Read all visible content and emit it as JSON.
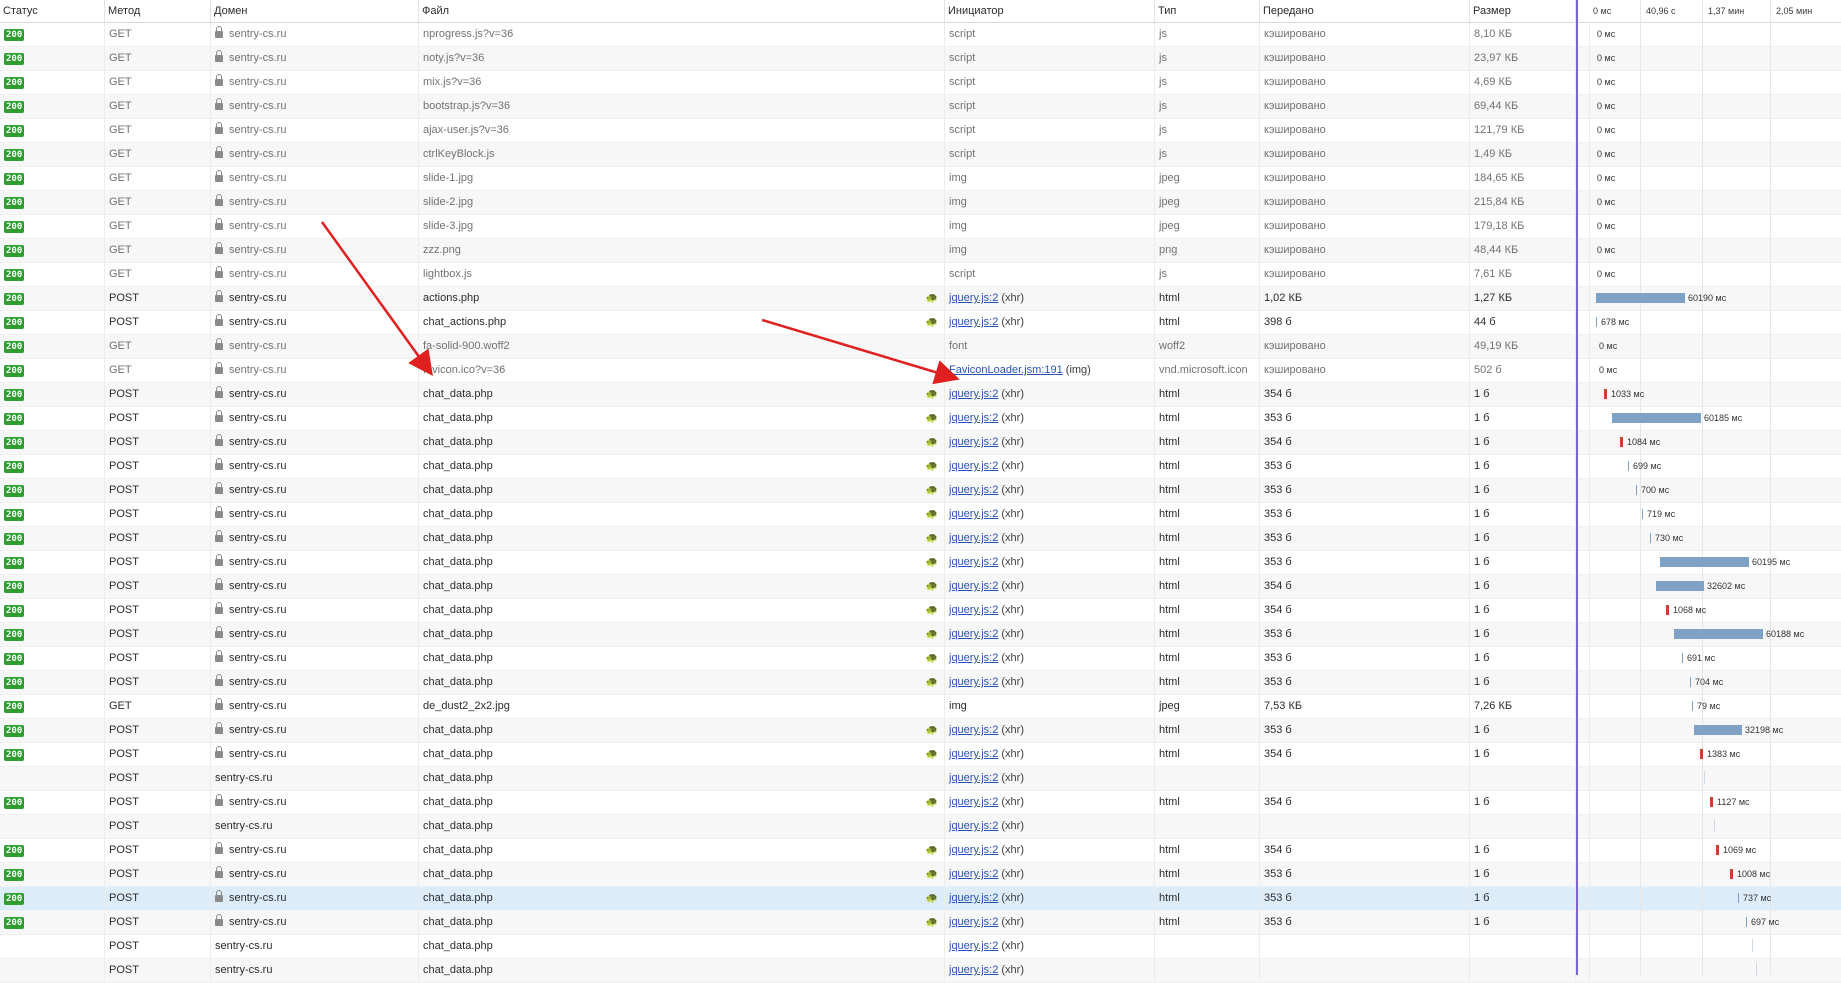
{
  "columns": {
    "status": "Статус",
    "method": "Метод",
    "domain": "Домен",
    "file": "Файл",
    "initiator": "Инициатор",
    "type": "Тип",
    "transferred": "Передано",
    "size": "Размер"
  },
  "timeline": {
    "ticks": [
      "0 мс",
      "40,96 с",
      "1,37 мин",
      "2,05 мин"
    ]
  },
  "colors": {
    "status_ok": "#2e9e2e",
    "bar": "#7fa1c5",
    "bar_red": "#d23b2f",
    "marker": "#7b63d0",
    "arrow": "#e02020",
    "link": "#2753b5",
    "selected": "#dcecf9"
  },
  "requests": [
    {
      "status": "200",
      "method": "GET",
      "domain": "sentry-cs.ru",
      "file": "nprogress.js?v=36",
      "initiator": "script",
      "init_suffix": "",
      "type": "js",
      "transferred": "кэшировано",
      "size": "8,10 КБ",
      "time": "0 мс",
      "cached": true
    },
    {
      "status": "200",
      "method": "GET",
      "domain": "sentry-cs.ru",
      "file": "noty.js?v=36",
      "initiator": "script",
      "init_suffix": "",
      "type": "js",
      "transferred": "кэшировано",
      "size": "23,97 КБ",
      "time": "0 мс",
      "cached": true
    },
    {
      "status": "200",
      "method": "GET",
      "domain": "sentry-cs.ru",
      "file": "mix.js?v=36",
      "initiator": "script",
      "init_suffix": "",
      "type": "js",
      "transferred": "кэшировано",
      "size": "4,69 КБ",
      "time": "0 мс",
      "cached": true
    },
    {
      "status": "200",
      "method": "GET",
      "domain": "sentry-cs.ru",
      "file": "bootstrap.js?v=36",
      "initiator": "script",
      "init_suffix": "",
      "type": "js",
      "transferred": "кэшировано",
      "size": "69,44 КБ",
      "time": "0 мс",
      "cached": true
    },
    {
      "status": "200",
      "method": "GET",
      "domain": "sentry-cs.ru",
      "file": "ajax-user.js?v=36",
      "initiator": "script",
      "init_suffix": "",
      "type": "js",
      "transferred": "кэшировано",
      "size": "121,79 КБ",
      "time": "0 мс",
      "cached": true
    },
    {
      "status": "200",
      "method": "GET",
      "domain": "sentry-cs.ru",
      "file": "ctrlKeyBlock.js",
      "initiator": "script",
      "init_suffix": "",
      "type": "js",
      "transferred": "кэшировано",
      "size": "1,49 КБ",
      "time": "0 мс",
      "cached": true
    },
    {
      "status": "200",
      "method": "GET",
      "domain": "sentry-cs.ru",
      "file": "slide-1.jpg",
      "initiator": "img",
      "init_suffix": "",
      "type": "jpeg",
      "transferred": "кэшировано",
      "size": "184,65 КБ",
      "time": "0 мс",
      "cached": true
    },
    {
      "status": "200",
      "method": "GET",
      "domain": "sentry-cs.ru",
      "file": "slide-2.jpg",
      "initiator": "img",
      "init_suffix": "",
      "type": "jpeg",
      "transferred": "кэшировано",
      "size": "215,84 КБ",
      "time": "0 мс",
      "cached": true
    },
    {
      "status": "200",
      "method": "GET",
      "domain": "sentry-cs.ru",
      "file": "slide-3.jpg",
      "initiator": "img",
      "init_suffix": "",
      "type": "jpeg",
      "transferred": "кэшировано",
      "size": "179,18 КБ",
      "time": "0 мс",
      "cached": true
    },
    {
      "status": "200",
      "method": "GET",
      "domain": "sentry-cs.ru",
      "file": "zzz.png",
      "initiator": "img",
      "init_suffix": "",
      "type": "png",
      "transferred": "кэшировано",
      "size": "48,44 КБ",
      "time": "0 мс",
      "cached": true
    },
    {
      "status": "200",
      "method": "GET",
      "domain": "sentry-cs.ru",
      "file": "lightbox.js",
      "initiator": "script",
      "init_suffix": "",
      "type": "js",
      "transferred": "кэшировано",
      "size": "7,61 КБ",
      "time": "0 мс",
      "cached": true
    },
    {
      "status": "200",
      "method": "POST",
      "domain": "sentry-cs.ru",
      "file": "actions.php",
      "initiator": "jquery.js:2",
      "init_suffix": " (xhr)",
      "type": "html",
      "transferred": "1,02 КБ",
      "size": "1,27 КБ",
      "time": "60190 мс",
      "turtle": true
    },
    {
      "status": "200",
      "method": "POST",
      "domain": "sentry-cs.ru",
      "file": "chat_actions.php",
      "initiator": "jquery.js:2",
      "init_suffix": " (xhr)",
      "type": "html",
      "transferred": "398 б",
      "size": "44 б",
      "time": "678 мс",
      "turtle": true
    },
    {
      "status": "200",
      "method": "GET",
      "domain": "sentry-cs.ru",
      "file": "fa-solid-900.woff2",
      "initiator": "font",
      "init_suffix": "",
      "type": "woff2",
      "transferred": "кэшировано",
      "size": "49,19 КБ",
      "time": "0 мс",
      "cached": true
    },
    {
      "status": "200",
      "method": "GET",
      "domain": "sentry-cs.ru",
      "file": "favicon.ico?v=36",
      "initiator": "FaviconLoader.jsm:191",
      "init_suffix": " (img)",
      "type": "vnd.microsoft.icon",
      "transferred": "кэшировано",
      "size": "502 б",
      "time": "0 мс",
      "cached": true
    },
    {
      "status": "200",
      "method": "POST",
      "domain": "sentry-cs.ru",
      "file": "chat_data.php",
      "initiator": "jquery.js:2",
      "init_suffix": " (xhr)",
      "type": "html",
      "transferred": "354 б",
      "size": "1 б",
      "time": "1033 мс",
      "turtle": true
    },
    {
      "status": "200",
      "method": "POST",
      "domain": "sentry-cs.ru",
      "file": "chat_data.php",
      "initiator": "jquery.js:2",
      "init_suffix": " (xhr)",
      "type": "html",
      "transferred": "353 б",
      "size": "1 б",
      "time": "60185 мс",
      "turtle": true
    },
    {
      "status": "200",
      "method": "POST",
      "domain": "sentry-cs.ru",
      "file": "chat_data.php",
      "initiator": "jquery.js:2",
      "init_suffix": " (xhr)",
      "type": "html",
      "transferred": "354 б",
      "size": "1 б",
      "time": "1084 мс",
      "turtle": true
    },
    {
      "status": "200",
      "method": "POST",
      "domain": "sentry-cs.ru",
      "file": "chat_data.php",
      "initiator": "jquery.js:2",
      "init_suffix": " (xhr)",
      "type": "html",
      "transferred": "353 б",
      "size": "1 б",
      "time": "699 мс",
      "turtle": true
    },
    {
      "status": "200",
      "method": "POST",
      "domain": "sentry-cs.ru",
      "file": "chat_data.php",
      "initiator": "jquery.js:2",
      "init_suffix": " (xhr)",
      "type": "html",
      "transferred": "353 б",
      "size": "1 б",
      "time": "700 мс",
      "turtle": true
    },
    {
      "status": "200",
      "method": "POST",
      "domain": "sentry-cs.ru",
      "file": "chat_data.php",
      "initiator": "jquery.js:2",
      "init_suffix": " (xhr)",
      "type": "html",
      "transferred": "353 б",
      "size": "1 б",
      "time": "719 мс",
      "turtle": true
    },
    {
      "status": "200",
      "method": "POST",
      "domain": "sentry-cs.ru",
      "file": "chat_data.php",
      "initiator": "jquery.js:2",
      "init_suffix": " (xhr)",
      "type": "html",
      "transferred": "353 б",
      "size": "1 б",
      "time": "730 мс",
      "turtle": true
    },
    {
      "status": "200",
      "method": "POST",
      "domain": "sentry-cs.ru",
      "file": "chat_data.php",
      "initiator": "jquery.js:2",
      "init_suffix": " (xhr)",
      "type": "html",
      "transferred": "353 б",
      "size": "1 б",
      "time": "60195 мс",
      "turtle": true
    },
    {
      "status": "200",
      "method": "POST",
      "domain": "sentry-cs.ru",
      "file": "chat_data.php",
      "initiator": "jquery.js:2",
      "init_suffix": " (xhr)",
      "type": "html",
      "transferred": "354 б",
      "size": "1 б",
      "time": "32602 мс",
      "turtle": true
    },
    {
      "status": "200",
      "method": "POST",
      "domain": "sentry-cs.ru",
      "file": "chat_data.php",
      "initiator": "jquery.js:2",
      "init_suffix": " (xhr)",
      "type": "html",
      "transferred": "354 б",
      "size": "1 б",
      "time": "1068 мс",
      "turtle": true
    },
    {
      "status": "200",
      "method": "POST",
      "domain": "sentry-cs.ru",
      "file": "chat_data.php",
      "initiator": "jquery.js:2",
      "init_suffix": " (xhr)",
      "type": "html",
      "transferred": "353 б",
      "size": "1 б",
      "time": "60188 мс",
      "turtle": true
    },
    {
      "status": "200",
      "method": "POST",
      "domain": "sentry-cs.ru",
      "file": "chat_data.php",
      "initiator": "jquery.js:2",
      "init_suffix": " (xhr)",
      "type": "html",
      "transferred": "353 б",
      "size": "1 б",
      "time": "691 мс",
      "turtle": true
    },
    {
      "status": "200",
      "method": "POST",
      "domain": "sentry-cs.ru",
      "file": "chat_data.php",
      "initiator": "jquery.js:2",
      "init_suffix": " (xhr)",
      "type": "html",
      "transferred": "353 б",
      "size": "1 б",
      "time": "704 мс",
      "turtle": true
    },
    {
      "status": "200",
      "method": "GET",
      "domain": "sentry-cs.ru",
      "file": "de_dust2_2x2.jpg",
      "initiator": "img",
      "init_suffix": "",
      "type": "jpeg",
      "transferred": "7,53 КБ",
      "size": "7,26 КБ",
      "time": "79 мс"
    },
    {
      "status": "200",
      "method": "POST",
      "domain": "sentry-cs.ru",
      "file": "chat_data.php",
      "initiator": "jquery.js:2",
      "init_suffix": " (xhr)",
      "type": "html",
      "transferred": "353 б",
      "size": "1 б",
      "time": "32198 мс",
      "turtle": true
    },
    {
      "status": "200",
      "method": "POST",
      "domain": "sentry-cs.ru",
      "file": "chat_data.php",
      "initiator": "jquery.js:2",
      "init_suffix": " (xhr)",
      "type": "html",
      "transferred": "354 б",
      "size": "1 б",
      "time": "1383 мс",
      "turtle": true
    },
    {
      "status": "",
      "method": "POST",
      "domain": "sentry-cs.ru",
      "file": "chat_data.php",
      "initiator": "jquery.js:2",
      "init_suffix": " (xhr)",
      "type": "",
      "transferred": "",
      "size": "",
      "time": "",
      "pending": true
    },
    {
      "status": "200",
      "method": "POST",
      "domain": "sentry-cs.ru",
      "file": "chat_data.php",
      "initiator": "jquery.js:2",
      "init_suffix": " (xhr)",
      "type": "html",
      "transferred": "354 б",
      "size": "1 б",
      "time": "1127 мс",
      "turtle": true
    },
    {
      "status": "",
      "method": "POST",
      "domain": "sentry-cs.ru",
      "file": "chat_data.php",
      "initiator": "jquery.js:2",
      "init_suffix": " (xhr)",
      "type": "",
      "transferred": "",
      "size": "",
      "time": "",
      "pending": true
    },
    {
      "status": "200",
      "method": "POST",
      "domain": "sentry-cs.ru",
      "file": "chat_data.php",
      "initiator": "jquery.js:2",
      "init_suffix": " (xhr)",
      "type": "html",
      "transferred": "354 б",
      "size": "1 б",
      "time": "1069 мс",
      "turtle": true
    },
    {
      "status": "200",
      "method": "POST",
      "domain": "sentry-cs.ru",
      "file": "chat_data.php",
      "initiator": "jquery.js:2",
      "init_suffix": " (xhr)",
      "type": "html",
      "transferred": "353 б",
      "size": "1 б",
      "time": "1008 мс",
      "turtle": true
    },
    {
      "status": "200",
      "method": "POST",
      "domain": "sentry-cs.ru",
      "file": "chat_data.php",
      "initiator": "jquery.js:2",
      "init_suffix": " (xhr)",
      "type": "html",
      "transferred": "353 б",
      "size": "1 б",
      "time": "737 мс",
      "turtle": true,
      "selected": true
    },
    {
      "status": "200",
      "method": "POST",
      "domain": "sentry-cs.ru",
      "file": "chat_data.php",
      "initiator": "jquery.js:2",
      "init_suffix": " (xhr)",
      "type": "html",
      "transferred": "353 б",
      "size": "1 б",
      "time": "697 мс",
      "turtle": true
    },
    {
      "status": "",
      "method": "POST",
      "domain": "sentry-cs.ru",
      "file": "chat_data.php",
      "initiator": "jquery.js:2",
      "init_suffix": " (xhr)",
      "type": "",
      "transferred": "",
      "size": "",
      "time": "",
      "pending": true
    },
    {
      "status": "",
      "method": "POST",
      "domain": "sentry-cs.ru",
      "file": "chat_data.php",
      "initiator": "jquery.js:2",
      "init_suffix": " (xhr)",
      "type": "",
      "transferred": "",
      "size": "",
      "time": "",
      "pending": true
    }
  ]
}
